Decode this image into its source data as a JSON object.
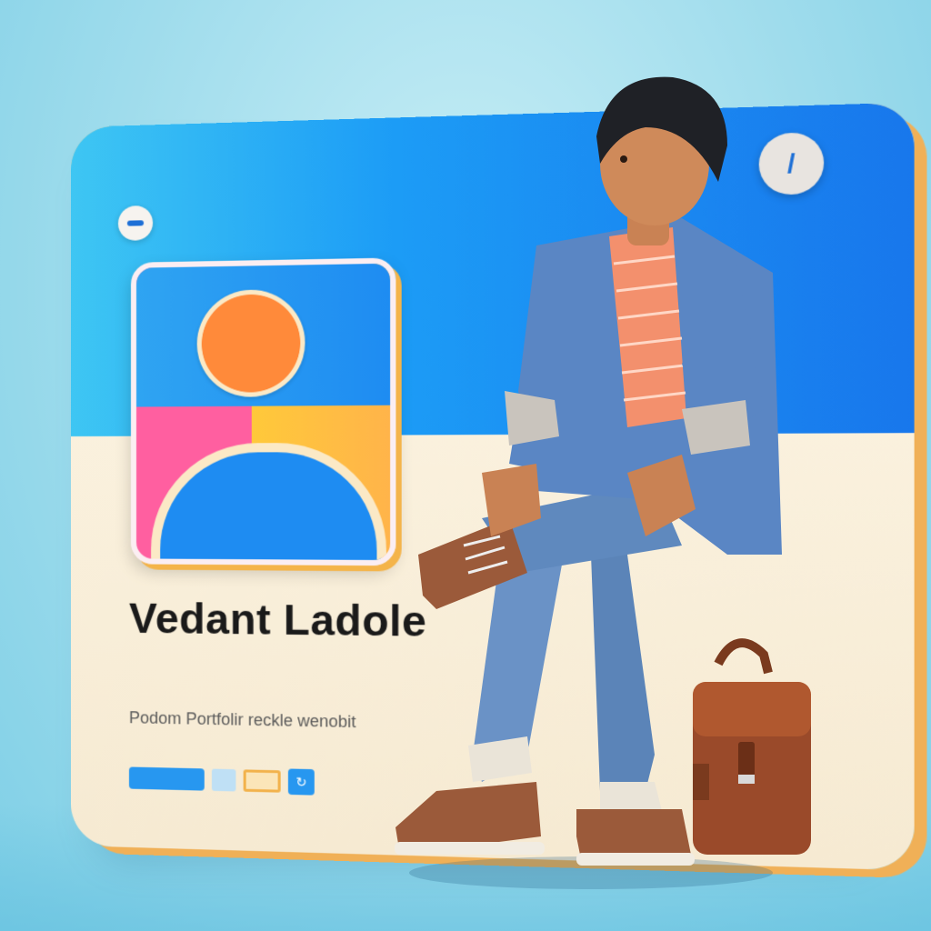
{
  "card": {
    "name": "Vedant Ladole",
    "tagline": "Podom Portfolir reckle wenobit"
  },
  "colors": {
    "card_top": "#1c9cf6",
    "card_bottom": "#f6ead2",
    "avatar_head": "#ff8a3a",
    "avatar_pink": "#ff5fa0",
    "avatar_yellow": "#ffc93a",
    "jacket": "#5a86c4",
    "jeans": "#5b84b8",
    "shoes": "#9b5a3a",
    "bag": "#9a4a2a"
  },
  "icons": [
    "minus-icon",
    "edit-icon",
    "avatar-icon",
    "backpack-icon"
  ]
}
